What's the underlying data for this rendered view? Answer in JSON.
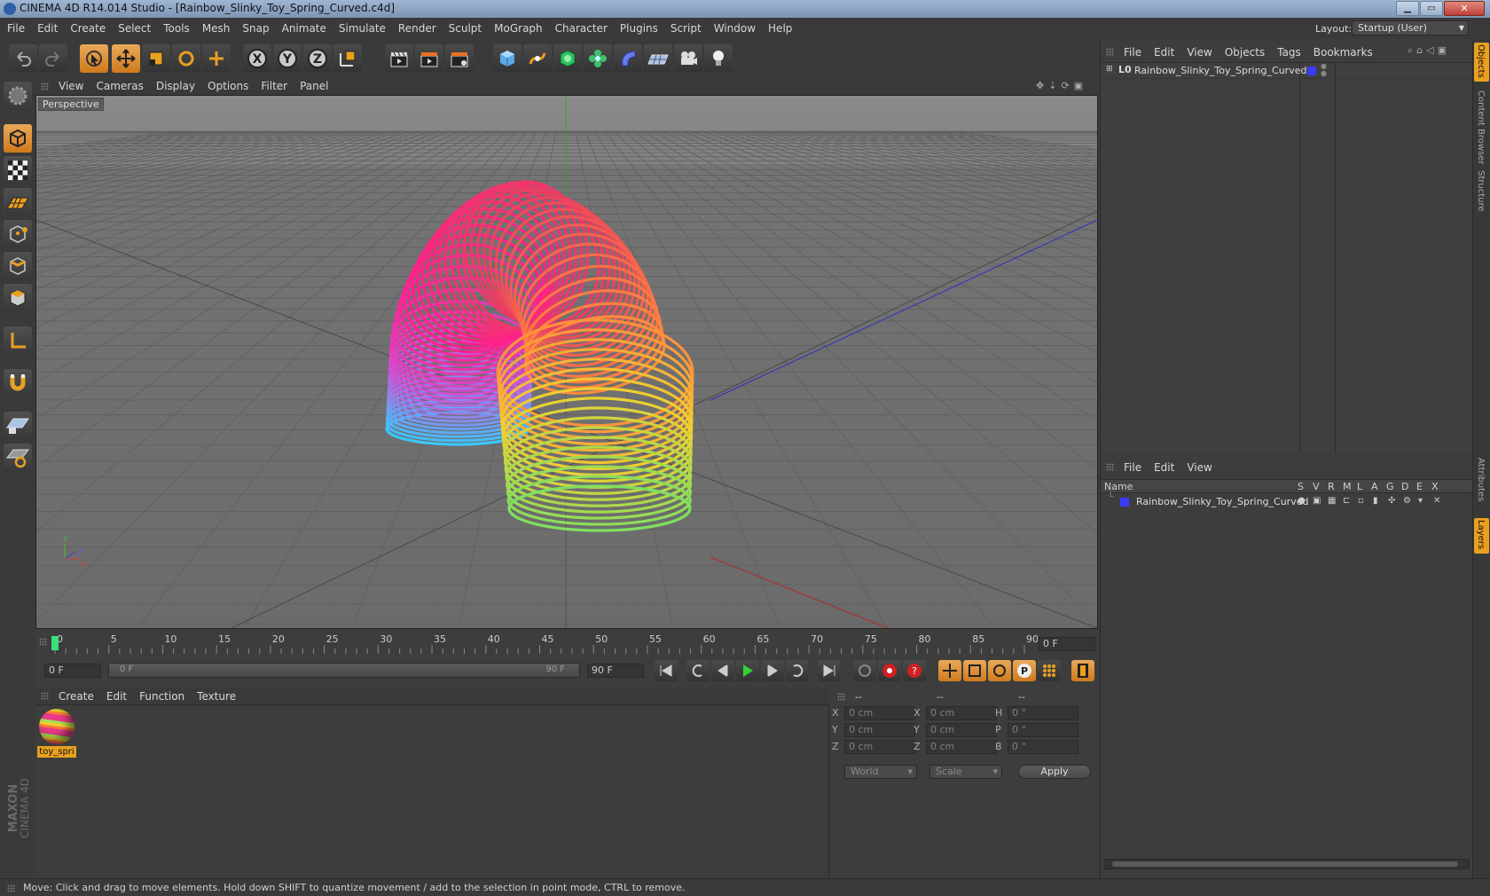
{
  "window": {
    "title": "CINEMA 4D R14.014 Studio - [Rainbow_Slinky_Toy_Spring_Curved.c4d]"
  },
  "menu": [
    "File",
    "Edit",
    "Create",
    "Select",
    "Tools",
    "Mesh",
    "Snap",
    "Animate",
    "Simulate",
    "Render",
    "Sculpt",
    "MoGraph",
    "Character",
    "Plugins",
    "Script",
    "Window",
    "Help"
  ],
  "layout": {
    "label": "Layout:",
    "value": "Startup (User)"
  },
  "viewport": {
    "menu": [
      "View",
      "Cameras",
      "Display",
      "Options",
      "Filter",
      "Panel"
    ],
    "label": "Perspective"
  },
  "timeline": {
    "ticks": [
      "0",
      "5",
      "10",
      "15",
      "20",
      "25",
      "30",
      "35",
      "40",
      "45",
      "50",
      "55",
      "60",
      "65",
      "70",
      "75",
      "80",
      "85",
      "90"
    ],
    "frame_display": "0 F",
    "start": "0 F",
    "range_start": "0 F",
    "range_end": "90 F",
    "end": "90 F"
  },
  "material_manager": {
    "menu": [
      "Create",
      "Edit",
      "Function",
      "Texture"
    ],
    "material_name": "toy_spri"
  },
  "coords": {
    "header": [
      "--",
      "--",
      "--"
    ],
    "rows": [
      {
        "a": "X",
        "av": "0 cm",
        "b": "X",
        "bv": "0 cm",
        "c": "H",
        "cv": "0 °"
      },
      {
        "a": "Y",
        "av": "0 cm",
        "b": "Y",
        "bv": "0 cm",
        "c": "P",
        "cv": "0 °"
      },
      {
        "a": "Z",
        "av": "0 cm",
        "b": "Z",
        "bv": "0 cm",
        "c": "B",
        "cv": "0 °"
      }
    ],
    "world": "World",
    "scale": "Scale",
    "apply": "Apply"
  },
  "objects_panel": {
    "menu": [
      "File",
      "Edit",
      "View",
      "Objects",
      "Tags",
      "Bookmarks"
    ],
    "object_name": "Rainbow_Slinky_Toy_Spring_Curved",
    "object_color": "#3a3aff"
  },
  "layers_panel": {
    "menu": [
      "File",
      "Edit",
      "View"
    ],
    "columns": [
      "Name",
      "S",
      "V",
      "R",
      "M",
      "L",
      "A",
      "G",
      "D",
      "E",
      "X"
    ],
    "layer_name": "Rainbow_Slinky_Toy_Spring_Curved"
  },
  "right_tabs": [
    "Objects",
    "Content Browser",
    "Structure",
    "Attributes",
    "Layers"
  ],
  "brand": {
    "line1": "MAXON",
    "line2": "CINEMA 4D"
  },
  "status": "Move: Click and drag to move elements. Hold down SHIFT to quantize movement / add to the selection in point mode, CTRL to remove.",
  "colors": {
    "accent": "#d4832a",
    "x_axis": "#c83030",
    "y_axis": "#30b030",
    "z_axis": "#3a3ad0"
  }
}
